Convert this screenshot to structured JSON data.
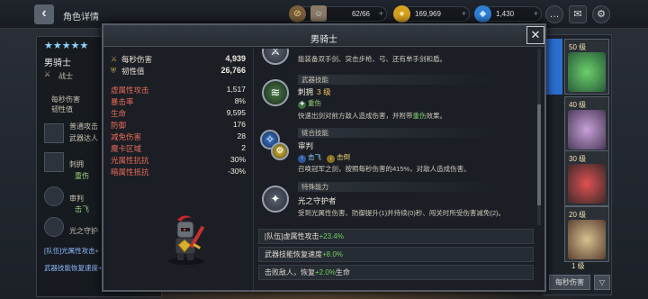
{
  "topbar": {
    "title": "角色详情",
    "stamina": "62/66",
    "gold": "169,969",
    "gems": "1,430"
  },
  "character": {
    "level": "50",
    "name": "男骑士",
    "role": "战士",
    "panel_stats": [
      "每秒伤害",
      "韧性值"
    ],
    "panel_skills": [
      "普通攻击",
      "武器达人",
      "刺拥",
      "重伤",
      "审判",
      "击飞",
      "光之守护"
    ],
    "panel_links": [
      "[队伍]光属性攻击+",
      "武器技能恢复速度+"
    ]
  },
  "modal": {
    "title": "男骑士",
    "stats_head": [
      {
        "label": "每秒伤害",
        "value": "4,939"
      },
      {
        "label": "韧性值",
        "value": "26,766"
      }
    ],
    "stats": [
      {
        "label": "虚属性攻击",
        "value": "1,517"
      },
      {
        "label": "暴击率",
        "value": "8%"
      },
      {
        "label": "生命",
        "value": "9,595"
      },
      {
        "label": "防御",
        "value": "176"
      },
      {
        "label": "减免伤害",
        "value": "28"
      },
      {
        "label": "魔卡区域",
        "value": "2"
      },
      {
        "label": "光属性抗抗",
        "value": "30%"
      },
      {
        "label": "暗属性抵抗",
        "value": "-30%"
      }
    ],
    "skills": [
      {
        "desc": "能装备双手剑、突击步枪、弓、还有单手剑和盾。"
      },
      {
        "category": "武器技能",
        "name": "刺拥",
        "level": "3 级",
        "tag": "重伤",
        "desc_a": "快速出剑对前方敌人造成伤害，并附带",
        "desc_hl": "重伤",
        "desc_b": "效果。"
      },
      {
        "category": "链合技能",
        "name": "审判",
        "tag1": "击飞",
        "tag2": "击倒",
        "desc": "召唤冠军之剑，按照每秒伤害的415%，对敌人造成伤害。"
      },
      {
        "category": "特殊能力",
        "name": "光之守护者",
        "desc": "受到光属性伤害、防御提升(1)并持续(0)秒、闯关时所受伤害减免(2)。"
      }
    ],
    "bonuses": [
      {
        "text": "[队伍]虚属性攻击",
        "value": "+23.4%"
      },
      {
        "text": "武器技能恢复速度",
        "value": "+8.0%"
      },
      {
        "text": "击败敌人，恢复",
        "value": "+2.0%",
        "suffix": "生命"
      }
    ]
  },
  "roster": {
    "levels": [
      "50 级",
      "40 级",
      "30 级",
      "20 级",
      "1 级"
    ],
    "sort_label": "每秒伤害",
    "filter_label": "▽"
  },
  "colors": {
    "accent_gold": "#e8c040",
    "green": "#6fd05a",
    "red_label": "#e86a5a",
    "blue_link": "#8fb8ff"
  }
}
